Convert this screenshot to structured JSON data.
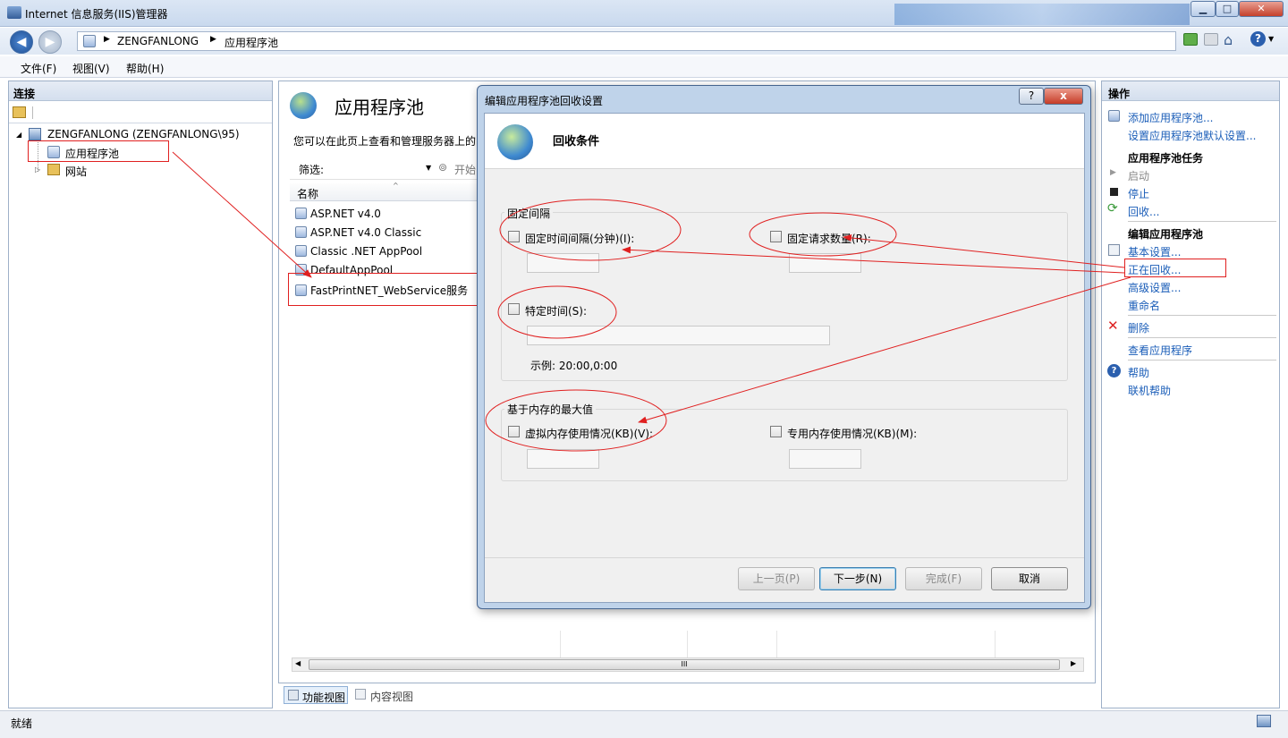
{
  "window": {
    "title": "Internet 信息服务(IIS)管理器"
  },
  "address": {
    "crumbs": [
      "ZENGFANLONG",
      "应用程序池"
    ]
  },
  "menu": {
    "items": [
      "文件(F)",
      "视图(V)",
      "帮助(H)"
    ]
  },
  "connections": {
    "header": "连接",
    "server_node": "ZENGFANLONG (ZENGFANLONG\\95)",
    "apppools_node": "应用程序池",
    "sites_node": "网站"
  },
  "center": {
    "title": "应用程序池",
    "description": "您可以在此页上查看和管理服务器上的",
    "filter_label": "筛选:",
    "go_label": "开始",
    "column_name": "名称",
    "pools": [
      "ASP.NET v4.0",
      "ASP.NET v4.0 Classic",
      "Classic .NET AppPool",
      "DefaultAppPool",
      "FastPrintNET_WebService服务"
    ],
    "scroll_mid": "III",
    "tab_features": "功能视图",
    "tab_content": "内容视图"
  },
  "actions": {
    "header": "操作",
    "add_pool": "添加应用程序池...",
    "set_defaults": "设置应用程序池默认设置...",
    "tasks_header": "应用程序池任务",
    "start": "启动",
    "stop": "停止",
    "recycle": "回收...",
    "edit_header": "编辑应用程序池",
    "basic": "基本设置...",
    "recycling": "正在回收...",
    "advanced": "高级设置...",
    "rename": "重命名",
    "remove": "删除",
    "view_apps": "查看应用程序",
    "help": "帮助",
    "online_help": "联机帮助"
  },
  "status": {
    "text": "就绪"
  },
  "dialog": {
    "title": "编辑应用程序池回收设置",
    "help_glyph": "?",
    "close_glyph": "x",
    "heading": "回收条件",
    "fixed_group": "固定间隔",
    "regular_interval": "固定时间间隔(分钟)(I):",
    "request_limit": "固定请求数量(R):",
    "specific_time": "特定时间(S):",
    "example": "示例: 20:00,0:00",
    "memory_group": "基于内存的最大值",
    "virtual_memory": "虚拟内存使用情况(KB)(V):",
    "private_memory": "专用内存使用情况(KB)(M):",
    "btn_prev": "上一页(P)",
    "btn_next": "下一步(N)",
    "btn_finish": "完成(F)",
    "btn_cancel": "取消"
  },
  "colors": {
    "annotation": "#e02020",
    "link": "#1a5db8"
  }
}
